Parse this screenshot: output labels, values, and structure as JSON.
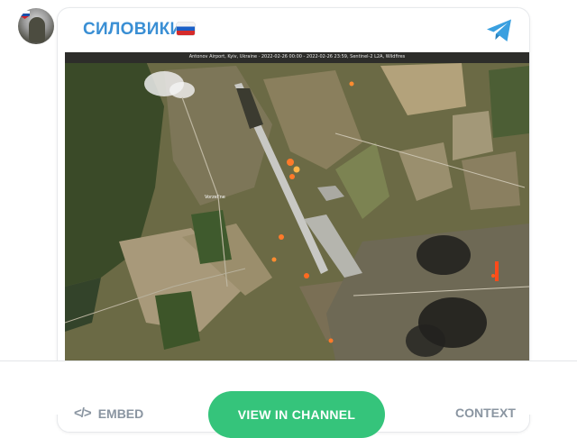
{
  "post": {
    "channel_title": "СИЛОВИКИ",
    "flag_icon": "russia-flag-icon",
    "messenger_icon": "telegram-icon",
    "image": {
      "caption": "Antonov Airport, Kyiv, Ukraine · 2022-02-26 00:00 - 2022-02-26 23:59, Sentinel-2 L2A, Wildfires",
      "place_label": "Vorzel'ne"
    }
  },
  "footer": {
    "embed_label": "EMBED",
    "embed_icon": "code-icon",
    "view_button_label": "VIEW IN CHANNEL",
    "context_label": "CONTEXT"
  },
  "colors": {
    "channel_title": "#3a8fd4",
    "telegram_blue": "#3aa0e0",
    "view_button": "#35c47b",
    "footer_text": "#8a95a1"
  }
}
